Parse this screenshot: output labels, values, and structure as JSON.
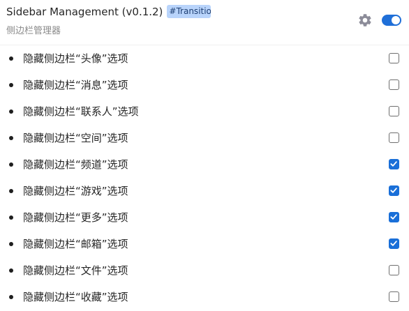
{
  "header": {
    "title": "Sidebar Management (v0.1.2)",
    "tag": "#Transitio",
    "subtitle": "侧边栏管理器",
    "settings_icon": "gear-icon",
    "enabled": true
  },
  "items": [
    {
      "label": "隐藏侧边栏“头像”选项",
      "checked": false
    },
    {
      "label": "隐藏侧边栏“消息”选项",
      "checked": false
    },
    {
      "label": "隐藏侧边栏“联系人”选项",
      "checked": false
    },
    {
      "label": "隐藏侧边栏“空间”选项",
      "checked": false
    },
    {
      "label": "隐藏侧边栏“频道”选项",
      "checked": true
    },
    {
      "label": "隐藏侧边栏“游戏”选项",
      "checked": true
    },
    {
      "label": "隐藏侧边栏“更多”选项",
      "checked": true
    },
    {
      "label": "隐藏侧边栏“邮箱”选项",
      "checked": true
    },
    {
      "label": "隐藏侧边栏“文件”选项",
      "checked": false
    },
    {
      "label": "隐藏侧边栏“收藏”选项",
      "checked": false
    }
  ],
  "colors": {
    "accent": "#1a6fd8",
    "tag_background": "#b9d4fb",
    "gear": "#8c8c99"
  }
}
